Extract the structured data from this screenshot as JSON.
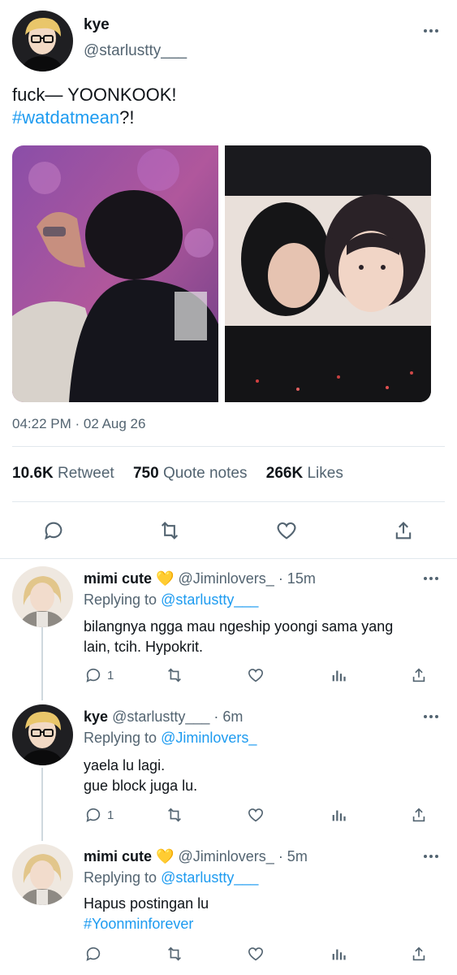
{
  "colors": {
    "link": "#1d9bf0",
    "muted": "#536471",
    "heart_emoji": "#f5c518"
  },
  "main_tweet": {
    "author_name": "kye",
    "author_handle": "@starlustty___",
    "text_line1": "fuck— YOONKOOK!",
    "hashtag": "#watdatmean",
    "text_suffix": "?!",
    "timestamp": "04:22 PM · 02 Aug 26",
    "stats": {
      "retweets_count": "10.6K",
      "retweets_label": "Retweet",
      "quotes_count": "750",
      "quotes_label": "Quote notes",
      "likes_count": "266K",
      "likes_label": "Likes"
    },
    "actions": [
      "reply-icon",
      "retweet-icon",
      "like-icon",
      "share-icon"
    ]
  },
  "replies": [
    {
      "name": "mimi cute",
      "emoji": "💛",
      "handle": "@Jiminlovers_",
      "time": "· 15m",
      "replying_label": "Replying to",
      "replying_to": "@starlustty___",
      "text_line1": "bilangnya ngga mau ngeship yoongi sama yang",
      "text_line2": "lain, tcih. Hypokrit.",
      "reply_count": "1"
    },
    {
      "name": "kye",
      "handle": "@starlustty___",
      "time": "· 6m",
      "replying_label": "Replying to",
      "replying_to": "@Jiminlovers_",
      "text_line1": "yaela lu lagi.",
      "text_line2": "gue block juga lu.",
      "reply_count": "1"
    },
    {
      "name": "mimi cute",
      "emoji": "💛",
      "handle": "@Jiminlovers_",
      "time": "· 5m",
      "replying_label": "Replying to",
      "replying_to": "@starlustty___",
      "text_line1": "Hapus postingan lu",
      "hashtag": "#Yoonminforever"
    }
  ]
}
